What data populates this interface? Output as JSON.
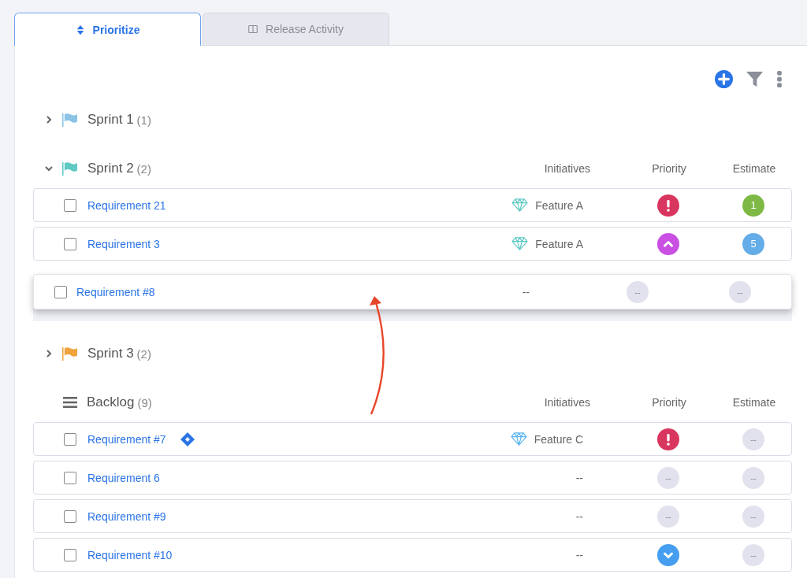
{
  "tabs": [
    {
      "label": "Prioritize",
      "selected": true,
      "kind": "sort"
    },
    {
      "label": "Release Activity",
      "selected": false,
      "kind": "columns"
    }
  ],
  "groups": [
    {
      "kind": "sprint",
      "name": "Sprint 1",
      "count": "(1)",
      "color": "#8cc4e6",
      "expanded": false
    },
    {
      "kind": "sprint",
      "name": "Sprint 2",
      "count": "(2)",
      "color": "#5fc9c4",
      "expanded": true,
      "columns": [
        "Initiatives",
        "Priority",
        "Estimate"
      ],
      "rows": [
        {
          "name": "Requirement 21",
          "checked": false,
          "synced": false,
          "initiative": {
            "label": "Feature A",
            "color": "#5fc9c4"
          },
          "priority": {
            "kind": "urgent"
          },
          "estimate": {
            "label": "1",
            "color": "#7db944"
          }
        },
        {
          "name": "Requirement 3",
          "checked": false,
          "synced": false,
          "initiative": {
            "label": "Feature A",
            "color": "#5fc9c4"
          },
          "priority": {
            "kind": "high"
          },
          "estimate": {
            "label": "5",
            "color": "#64ade8"
          }
        }
      ],
      "dragged_row": {
        "name": "Requirement #8",
        "checked": false,
        "initiative": {
          "label": "--"
        },
        "priority": {
          "kind": "none",
          "label": "--"
        },
        "estimate": {
          "label": "--",
          "color": "#e2e2ee"
        }
      }
    },
    {
      "kind": "sprint",
      "name": "Sprint 3",
      "count": "(2)",
      "color": "#f0a33c",
      "expanded": false
    },
    {
      "kind": "backlog",
      "name": "Backlog",
      "count": "(9)",
      "columns": [
        "Initiatives",
        "Priority",
        "Estimate"
      ],
      "rows": [
        {
          "name": "Requirement #7",
          "checked": false,
          "synced": true,
          "initiative": {
            "label": "Feature C",
            "color": "#5ab4f0"
          },
          "priority": {
            "kind": "urgent"
          },
          "estimate": {
            "label": "--",
            "color": "#e2e2ee"
          }
        },
        {
          "name": "Requirement 6",
          "checked": false,
          "synced": false,
          "initiative": {
            "label": "--"
          },
          "priority": {
            "kind": "none",
            "label": "--"
          },
          "estimate": {
            "label": "--",
            "color": "#e2e2ee"
          }
        },
        {
          "name": "Requirement #9",
          "checked": false,
          "synced": false,
          "initiative": {
            "label": "--"
          },
          "priority": {
            "kind": "none",
            "label": "--"
          },
          "estimate": {
            "label": "--",
            "color": "#e2e2ee"
          }
        },
        {
          "name": "Requirement #10",
          "checked": false,
          "synced": false,
          "initiative": {
            "label": "--"
          },
          "priority": {
            "kind": "low"
          },
          "estimate": {
            "label": "--",
            "color": "#e2e2ee"
          }
        }
      ]
    }
  ]
}
